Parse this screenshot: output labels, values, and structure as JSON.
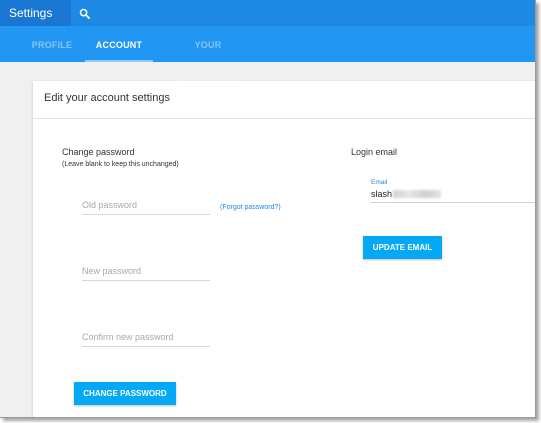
{
  "app": {
    "title": "Settings"
  },
  "icons": {
    "search": "search-icon"
  },
  "tabs": [
    {
      "label": "PROFILE",
      "active": false
    },
    {
      "label": "ACCOUNT",
      "active": true
    },
    {
      "label": "YOUR PREFERENCES",
      "active": false
    }
  ],
  "colors": {
    "header": "#1e88e5",
    "tabs_bar": "#2196f3",
    "button": "#03a9f4",
    "link": "#1e88e5"
  },
  "card": {
    "title": "Edit your account settings",
    "password": {
      "heading": "Change password",
      "hint": "(Leave blank to keep this unchanged)",
      "old_placeholder": "Old password",
      "forgot_link": "(Forgot password?)",
      "new_placeholder": "New password",
      "confirm_placeholder": "Confirm new password",
      "button_label": "CHANGE PASSWORD"
    },
    "email": {
      "heading": "Login email",
      "field_label": "Email",
      "value_visible": "slash",
      "button_label": "UPDATE EMAIL"
    }
  }
}
